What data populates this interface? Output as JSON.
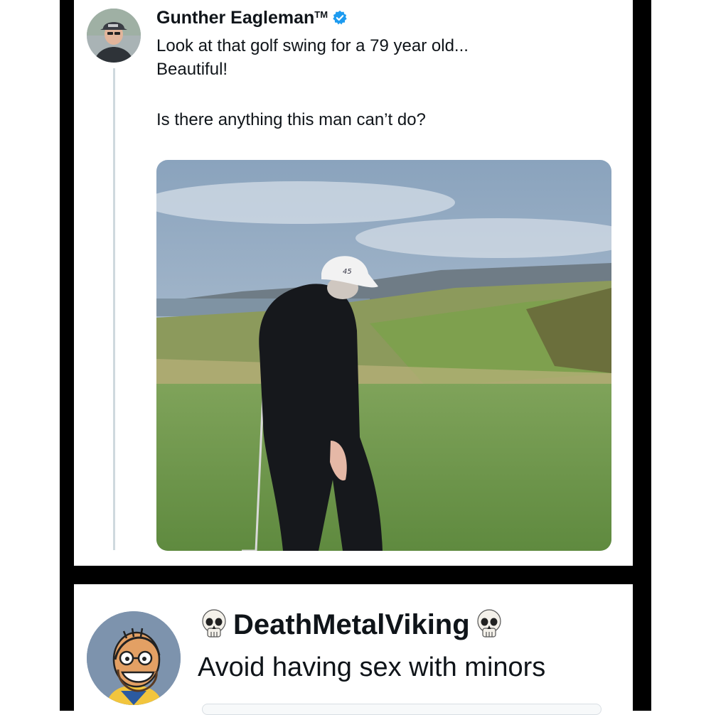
{
  "post": {
    "author": {
      "name": "Gunther Eagleman",
      "trademark": "TM",
      "verified": true,
      "avatar_icon": "profile-photo"
    },
    "text_lines": [
      "Look at that golf swing for a 79 year old...",
      "Beautiful!"
    ],
    "text_line_2": "Is there anything this man can’t do?",
    "media_icon": "golf-photo"
  },
  "reply": {
    "author": {
      "name": "DeathMetalViking",
      "left_emoji": "skull-icon",
      "right_emoji": "skull-icon",
      "avatar_icon": "cartoon-avatar"
    },
    "text": "Avoid having sex with minors"
  },
  "colors": {
    "verified_blue": "#1d9bf0",
    "text": "#0f1419",
    "thread_line": "#cfd9de",
    "frame": "#000000"
  }
}
